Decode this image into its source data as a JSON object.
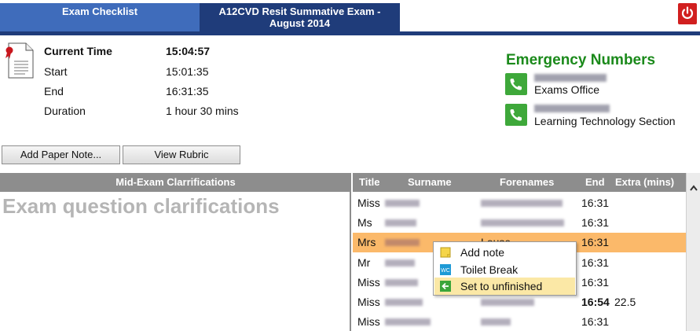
{
  "tabs": [
    {
      "label": "Exam Checklist"
    },
    {
      "label_line1": "A12CVD Resit Summative Exam -",
      "label_line2": "August 2014"
    }
  ],
  "info": {
    "current_time_label": "Current Time",
    "current_time_value": "15:04:57",
    "start_label": "Start",
    "start_value": "15:01:35",
    "end_label": "End",
    "end_value": "16:31:35",
    "duration_label": "Duration",
    "duration_value": "1 hour 30 mins"
  },
  "emergency": {
    "title": "Emergency Numbers",
    "contacts": [
      {
        "label": "Exams Office"
      },
      {
        "label": "Learning Technology Section"
      }
    ]
  },
  "buttons": {
    "add_paper_note": "Add Paper Note...",
    "view_rubric": "View Rubric"
  },
  "clarifications": {
    "header": "Mid-Exam Clarrifications",
    "title": "Exam question clarifications"
  },
  "table": {
    "columns": [
      "Title",
      "Surname",
      "Forenames",
      "End",
      "Extra (mins)"
    ],
    "rows": [
      {
        "title": "Miss",
        "forenames": "",
        "end": "16:31",
        "extra": ""
      },
      {
        "title": "Ms",
        "forenames": "",
        "end": "16:31",
        "extra": ""
      },
      {
        "title": "Mrs",
        "forenames": "Louse",
        "end": "16:31",
        "extra": ""
      },
      {
        "title": "Mr",
        "forenames": "",
        "end": "16:31",
        "extra": ""
      },
      {
        "title": "Miss",
        "forenames": "",
        "end": "16:31",
        "extra": ""
      },
      {
        "title": "Miss",
        "forenames": "",
        "end": "16:54",
        "extra": "22.5"
      },
      {
        "title": "Miss",
        "forenames": "",
        "end": "16:31",
        "extra": ""
      }
    ]
  },
  "context_menu": {
    "items": [
      {
        "label": "Add note",
        "icon": "note-icon"
      },
      {
        "label": "Toilet Break",
        "icon": "wc-icon"
      },
      {
        "label": "Set to unfinished",
        "icon": "back-arrow-icon"
      }
    ]
  },
  "colors": {
    "tab_active": "#1f3c7a",
    "tab_inactive": "#3f6cbb",
    "emergency_green": "#1b8a1b",
    "row_highlight": "#fbb96a",
    "menu_highlight": "#fbe8a6",
    "power_red": "#d11f1f"
  }
}
